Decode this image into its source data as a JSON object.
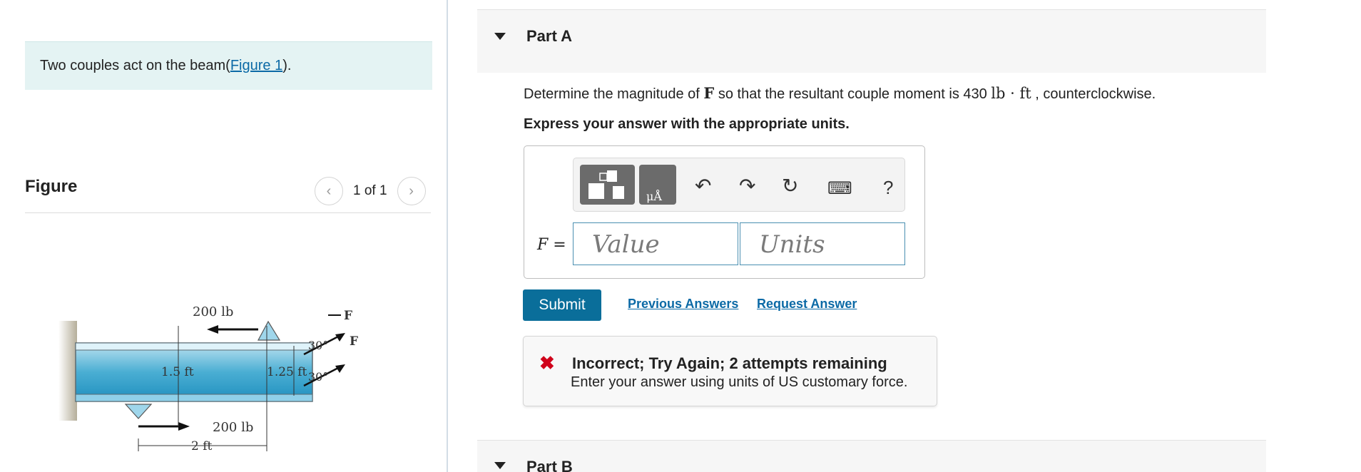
{
  "left": {
    "intro_text": "Two couples act on the beam(",
    "intro_link": "Figure 1",
    "intro_end": ").",
    "figure_title": "Figure",
    "figure_count": "1 of 1",
    "prev_icon": "chevron-left-icon",
    "next_icon": "chevron-right-icon",
    "diagram_labels": {
      "force_top": "200 lb",
      "force_bottom": "200 lb",
      "dim_height": "1.5 ft",
      "dim_right": "1.25 ft",
      "dim_width": "2 ft",
      "angle_top": "30°",
      "angle_bottom": "30°",
      "force_f_top": "F",
      "force_f_right": "F"
    }
  },
  "part_a": {
    "label": "Part A",
    "question_pre": "Determine the magnitude of ",
    "question_var": "F",
    "question_mid": " so that the resultant couple moment is 430 ",
    "question_units": "lb · ft",
    "question_post": " , counterclockwise.",
    "express": "Express your answer with the appropriate units.",
    "answer_label": "F =",
    "value_placeholder": "Value",
    "units_placeholder": "Units",
    "toolbar": {
      "templates_icon": "templates-icon",
      "units_icon": "units-angstrom-icon",
      "undo_icon": "undo-icon",
      "redo_icon": "redo-icon",
      "reset_icon": "reset-icon",
      "keyboard_icon": "keyboard-icon",
      "help_label": "?"
    },
    "submit_label": "Submit",
    "previous_answers_label": "Previous Answers",
    "request_answer_label": "Request Answer",
    "feedback": {
      "title": "Incorrect; Try Again; 2 attempts remaining",
      "body": "Enter your answer using units of US customary force."
    }
  },
  "part_b": {
    "label": "Part B"
  },
  "colors": {
    "accent": "#0a6e9a",
    "link": "#0c6aa6",
    "error": "#d0021b",
    "intro_bg": "#e4f3f3"
  }
}
